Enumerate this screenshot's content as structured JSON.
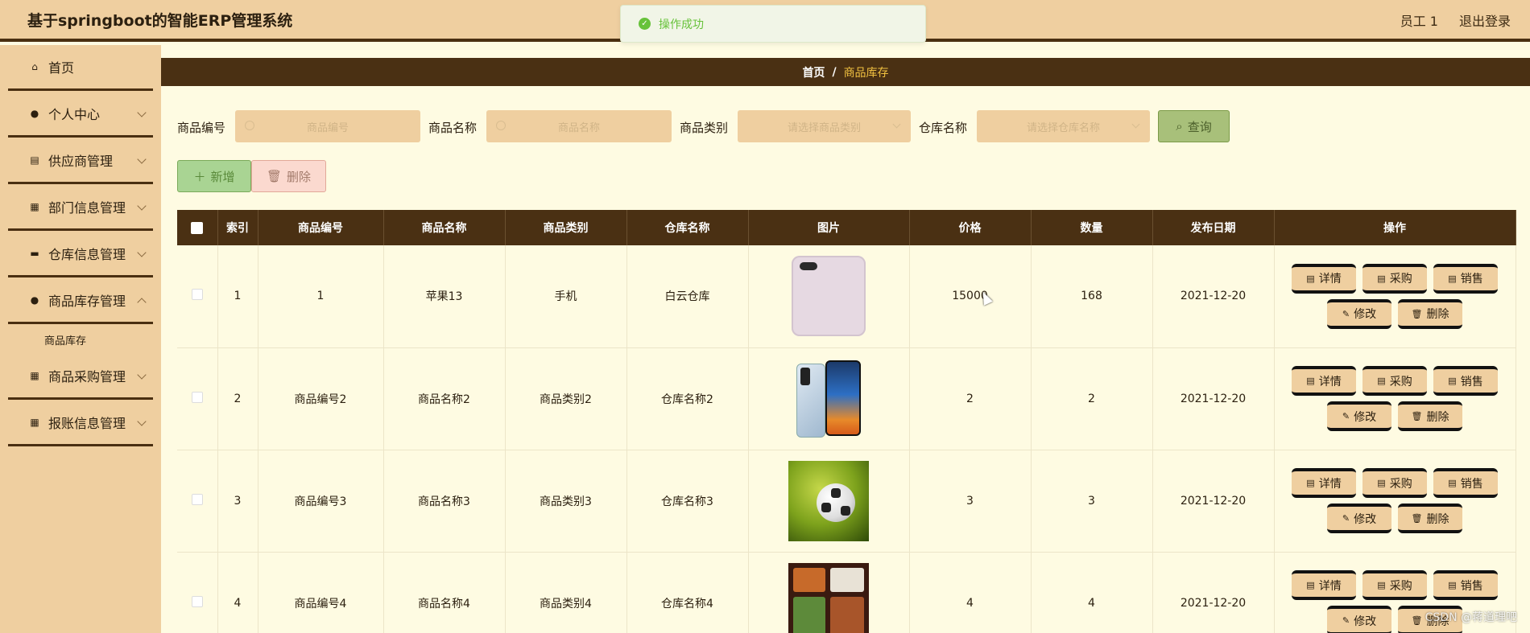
{
  "header": {
    "title": "基于springboot的智能ERP管理系统",
    "user": "员工 1",
    "logout": "退出登录"
  },
  "toast": {
    "message": "操作成功"
  },
  "sidebar": {
    "items": [
      {
        "label": "首页",
        "icon": "home-icon",
        "expandable": false
      },
      {
        "label": "个人中心",
        "icon": "user-icon",
        "expandable": true
      },
      {
        "label": "供应商管理",
        "icon": "clipboard-icon",
        "expandable": true
      },
      {
        "label": "部门信息管理",
        "icon": "grid-icon",
        "expandable": true
      },
      {
        "label": "仓库信息管理",
        "icon": "box-icon",
        "expandable": true
      },
      {
        "label": "商品库存管理",
        "icon": "user-icon",
        "expandable": true
      },
      {
        "label": "商品采购管理",
        "icon": "grid-icon",
        "expandable": true
      },
      {
        "label": "报账信息管理",
        "icon": "grid-icon",
        "expandable": true
      }
    ],
    "sub_item": "商品库存"
  },
  "breadcrumb": {
    "home": "首页",
    "separator": "/",
    "current": "商品库存"
  },
  "search": {
    "code_label": "商品编号",
    "code_placeholder": "商品编号",
    "name_label": "商品名称",
    "name_placeholder": "商品名称",
    "category_label": "商品类别",
    "category_placeholder": "请选择商品类别",
    "warehouse_label": "仓库名称",
    "warehouse_placeholder": "请选择仓库名称",
    "query_button": "查询"
  },
  "actions": {
    "add": "新增",
    "delete": "删除"
  },
  "table": {
    "columns": [
      "索引",
      "商品编号",
      "商品名称",
      "商品类别",
      "仓库名称",
      "图片",
      "价格",
      "数量",
      "发布日期",
      "操作"
    ],
    "rows": [
      {
        "index": "1",
        "code": "1",
        "name": "苹果13",
        "category": "手机",
        "warehouse": "白云仓库",
        "image": "iphone",
        "price": "15000",
        "qty": "168",
        "date": "2021-12-20"
      },
      {
        "index": "2",
        "code": "商品编号2",
        "name": "商品名称2",
        "category": "商品类别2",
        "warehouse": "仓库名称2",
        "image": "huawei-phones",
        "price": "2",
        "qty": "2",
        "date": "2021-12-20"
      },
      {
        "index": "3",
        "code": "商品编号3",
        "name": "商品名称3",
        "category": "商品类别3",
        "warehouse": "仓库名称3",
        "image": "soccer-ball",
        "price": "3",
        "qty": "3",
        "date": "2021-12-20"
      },
      {
        "index": "4",
        "code": "商品编号4",
        "name": "商品名称4",
        "category": "商品类别4",
        "warehouse": "仓库名称4",
        "image": "food-box",
        "price": "4",
        "qty": "4",
        "date": "2021-12-20"
      }
    ],
    "row_ops": {
      "detail": "详情",
      "purchase": "采购",
      "sell": "销售",
      "edit": "修改",
      "remove": "删除"
    }
  },
  "watermark": "CSDN @蒋道理吧"
}
